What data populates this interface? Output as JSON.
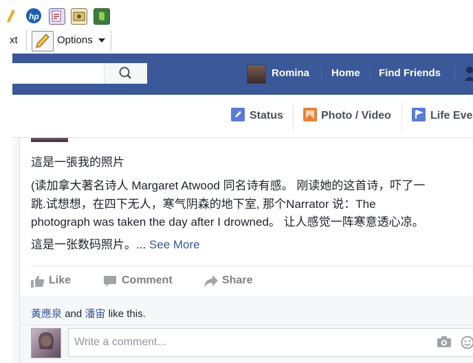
{
  "toolbar": {
    "partial_text": "xt",
    "options_label": "Options",
    "icons": [
      "orange-pen-icon",
      "hp-icon",
      "pdf-icon",
      "image-tool-icon",
      "evernote-icon",
      "pencil-icon"
    ]
  },
  "header": {
    "user_name": "Romina",
    "nav": [
      "Home",
      "Find Friends"
    ],
    "brand_color": "#3b5998"
  },
  "composer": {
    "status": "Status",
    "photo_video": "Photo / Video",
    "life_event": "Life Eve"
  },
  "post": {
    "line1": "這是一張我的照片",
    "line2": "(读加拿大著名诗人 Margaret Atwood 同名诗有感。 刚读她的这首诗，吓了一",
    "line3": "跳.试想想，在四下无人，寒气阴森的地下室, 那个Narrator 说：The",
    "line4": "photograph was taken the day after I drowned。 让人感觉一阵寒意透心凉。",
    "line5": "這是一张数码照片。...",
    "see_more": "See More"
  },
  "actions": {
    "like": "Like",
    "comment": "Comment",
    "share": "Share"
  },
  "likes": {
    "person1": "黃應泉",
    "and": "and",
    "person2": "潘宙",
    "suffix": "like this."
  },
  "comment_box": {
    "placeholder": "Write a comment..."
  }
}
